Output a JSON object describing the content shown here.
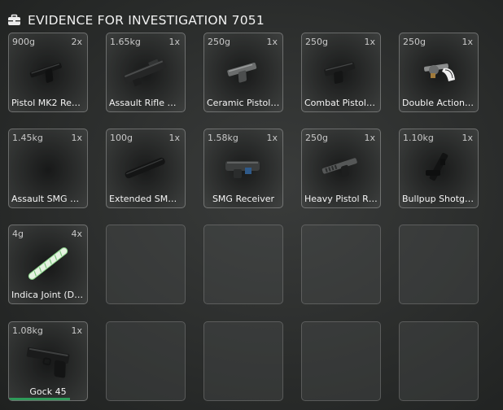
{
  "header": {
    "title": "EVIDENCE FOR INVESTIGATION 7051",
    "icon": "briefcase-icon"
  },
  "slots": [
    {
      "weight": "900g",
      "count": "2x",
      "label": "Pistol MK2 Rec…",
      "icon": "pistol-icon"
    },
    {
      "weight": "1.65kg",
      "count": "1x",
      "label": "Assault Rifle M…",
      "icon": "rifle-receiver-icon"
    },
    {
      "weight": "250g",
      "count": "1x",
      "label": "Ceramic Pistol …",
      "icon": "ceramic-pistol-icon"
    },
    {
      "weight": "250g",
      "count": "1x",
      "label": "Combat Pistol …",
      "icon": "combat-pistol-icon"
    },
    {
      "weight": "250g",
      "count": "1x",
      "label": "Double Action …",
      "icon": "revolver-icon"
    },
    {
      "weight": "1.45kg",
      "count": "1x",
      "label": "Assault SMG R…",
      "icon": ""
    },
    {
      "weight": "100g",
      "count": "1x",
      "label": "Extended SMG…",
      "icon": "magazine-icon"
    },
    {
      "weight": "1.58kg",
      "count": "1x",
      "label": "SMG Receiver",
      "icon": "smg-receiver-icon"
    },
    {
      "weight": "250g",
      "count": "1x",
      "label": "Heavy Pistol R…",
      "icon": "heavy-pistol-icon"
    },
    {
      "weight": "1.10kg",
      "count": "1x",
      "label": "Bullpup Shotg…",
      "icon": "shotgun-icon"
    },
    {
      "weight": "4g",
      "count": "4x",
      "label": "Indica Joint (D…",
      "icon": "joint-icon"
    },
    {
      "weight": "",
      "count": "",
      "label": "",
      "icon": ""
    },
    {
      "weight": "",
      "count": "",
      "label": "",
      "icon": ""
    },
    {
      "weight": "",
      "count": "",
      "label": "",
      "icon": ""
    },
    {
      "weight": "",
      "count": "",
      "label": "",
      "icon": ""
    },
    {
      "weight": "1.08kg",
      "count": "1x",
      "label": "Gock 45",
      "icon": "glock-icon",
      "durability": 0.78
    },
    {
      "weight": "",
      "count": "",
      "label": "",
      "icon": ""
    },
    {
      "weight": "",
      "count": "",
      "label": "",
      "icon": ""
    },
    {
      "weight": "",
      "count": "",
      "label": "",
      "icon": ""
    },
    {
      "weight": "",
      "count": "",
      "label": "",
      "icon": ""
    }
  ],
  "colors": {
    "durability_bar": "#2f9b5a"
  }
}
